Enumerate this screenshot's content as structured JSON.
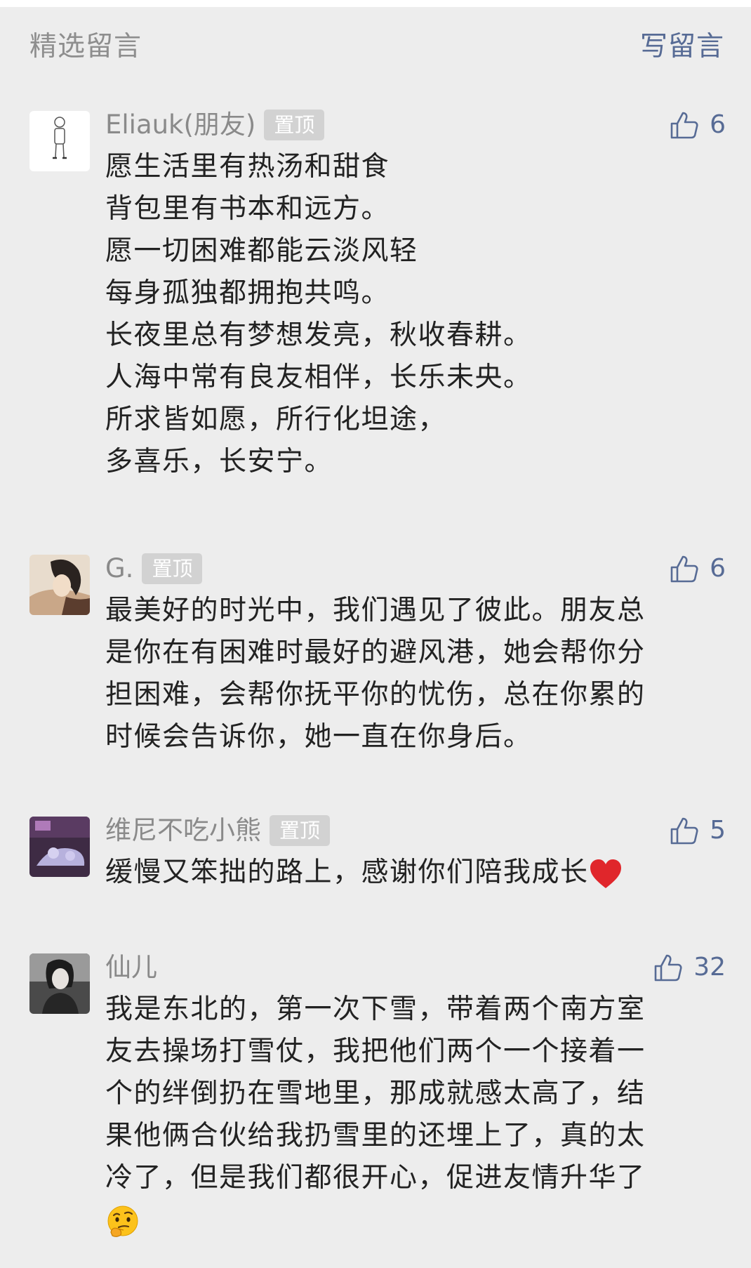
{
  "header": {
    "title": "精选留言",
    "write_label": "写留言"
  },
  "pin_label": "置顶",
  "comments": [
    {
      "name": "Eliauk(朋友)",
      "pinned": true,
      "likes": "6",
      "lines": [
        "愿生活里有热汤和甜食",
        "背包里有书本和远方。",
        "愿一切困难都能云淡风轻",
        "每身孤独都拥抱共鸣。",
        "长夜里总有梦想发亮，秋收春耕。",
        "人海中常有良友相伴，长乐未央。",
        "所求皆如愿，所行化坦途，",
        "多喜乐，长安宁。"
      ]
    },
    {
      "name": "G.",
      "pinned": true,
      "likes": "6",
      "lines": [
        "最美好的时光中，我们遇见了彼此。朋友总",
        "是你在有困难时最好的避风港，她会帮你分",
        "担困难，会帮你抚平你的忧伤，总在你累的",
        "时候会告诉你，她一直在你身后。"
      ]
    },
    {
      "name": "维尼不吃小熊",
      "pinned": true,
      "likes": "5",
      "lines": [
        "缓慢又笨拙的路上，感谢你们陪我成长"
      ],
      "trailing_emoji": "red-heart"
    },
    {
      "name": "仙儿",
      "pinned": false,
      "likes": "32",
      "lines": [
        "我是东北的，第一次下雪，带着两个南方室",
        "友去操场打雪仗，我把他们两个一个接着一",
        "个的绊倒扔在雪地里，那成就感太高了，结",
        "果他俩合伙给我扔雪里的还埋上了，真的太",
        "冷了，但是我们都很开心，促进友情升华了"
      ],
      "trailing_emoji_line": "thinking-face"
    }
  ],
  "colors": {
    "background": "#ededed",
    "link_blue": "#576b95",
    "muted_gray": "#8a8a8a",
    "pin_badge": "#d2d2d2",
    "text": "#222222"
  }
}
